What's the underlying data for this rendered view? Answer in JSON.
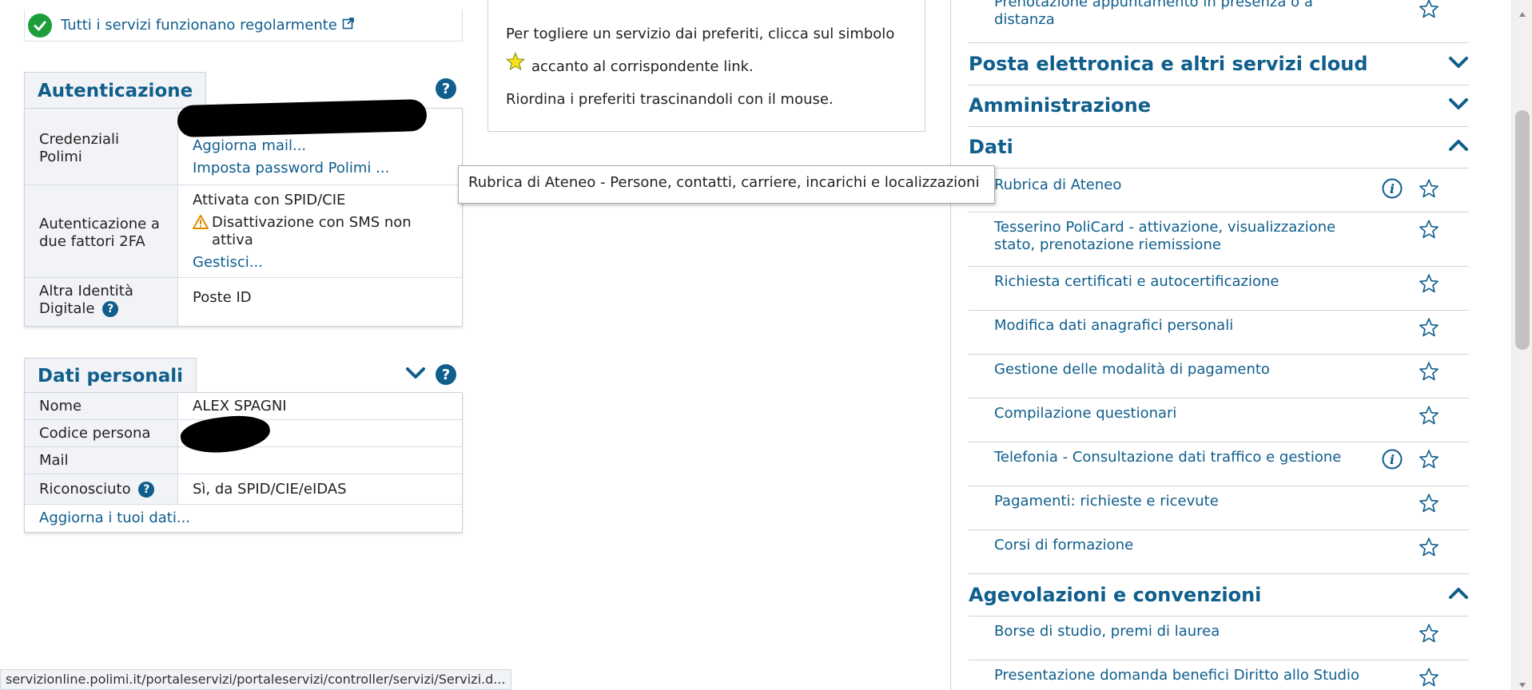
{
  "status": {
    "text": "Tutti i servizi funzionano regolarmente"
  },
  "auth": {
    "title": "Autenticazione",
    "rows": [
      {
        "key": "Credenziali Polimi",
        "links": [
          "Aggiorna mail...",
          "Imposta password Polimi ..."
        ]
      },
      {
        "key": "Autenticazione a due fattori 2FA",
        "value": "Attivata con SPID/CIE",
        "warning": "Disattivazione con SMS non attiva",
        "link": "Gestisci..."
      },
      {
        "key": "Altra Identità Digitale",
        "value": "Poste ID"
      }
    ]
  },
  "personal": {
    "title": "Dati personali",
    "rows": [
      {
        "key": "Nome",
        "value": "ALEX SPAGNI"
      },
      {
        "key": "Codice persona",
        "value": ""
      },
      {
        "key": "Mail",
        "value": ""
      },
      {
        "key": "Riconosciuto",
        "value": "Sì, da SPID/CIE/eIDAS"
      }
    ],
    "update_link": "Aggiorna i tuoi dati..."
  },
  "info": {
    "line1": "Per togliere un servizio dai preferiti, clicca sul simbolo",
    "line2": "accanto al corrispondente link.",
    "line3": "Riordina i preferiti trascinandoli con il mouse."
  },
  "tooltip": "Rubrica di Ateneo - Persone, contatti, carriere, incarichi e localizzazioni",
  "right": {
    "top_item": "Prenotazione appuntamento in presenza o a distanza",
    "sections": {
      "posta": "Posta elettronica e altri servizi cloud",
      "amministrazione": "Amministrazione",
      "dati": "Dati",
      "agevolazioni": "Agevolazioni e convenzioni"
    },
    "dati_items": [
      "Rubrica di Ateneo",
      "Tesserino PoliCard - attivazione, visualizzazione stato, prenotazione riemissione",
      "Richiesta certificati e autocertificazione",
      "Modifica dati anagrafici personali",
      "Gestione delle modalità di pagamento",
      "Compilazione questionari",
      "Telefonia - Consultazione dati traffico e gestione",
      "Pagamenti: richieste e ricevute",
      "Corsi di formazione"
    ],
    "agev_items": [
      "Borse di studio, premi di laurea",
      "Presentazione domanda benefici Diritto allo Studio"
    ]
  },
  "url_status": "servizionline.polimi.it/portaleservizi/portaleservizi/controller/servizi/Servizi.d...",
  "colors": {
    "link": "#0f5e8c",
    "ok": "#1e9e3b",
    "warning": "#e08a00",
    "panel_bg": "#f1f3f6"
  }
}
